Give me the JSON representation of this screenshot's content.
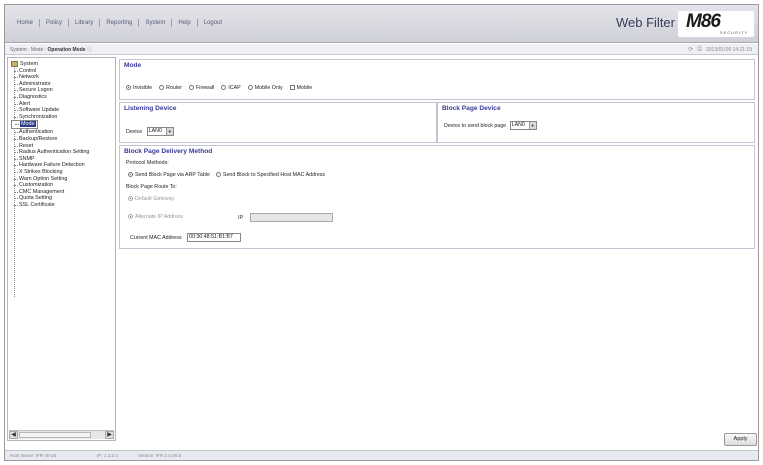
{
  "menu": [
    "Home",
    "Policy",
    "Library",
    "Reporting",
    "System",
    "Help",
    "Logout"
  ],
  "product_name": "Web Filter",
  "logo": {
    "main": "M86",
    "sub": "SECURITY"
  },
  "breadcrumb": {
    "prefix": "System : Mode : ",
    "current": "Operation Mode",
    "help_icon": "question-icon"
  },
  "datetime": "2013/01/09 14:21:19",
  "sidebar": {
    "root": "System",
    "items": [
      "Control",
      "Network",
      "Administrator",
      "Secure Logon",
      "Diagnostics",
      "Alert",
      "Software Update",
      "Synchronization",
      "Mode",
      "Authentication",
      "Backup/Restore",
      "Reset",
      "Radius Authentication Setting",
      "SNMP",
      "Hardware Failure Detection",
      "X Strikes Blocking",
      "Warn Option Setting",
      "Customization",
      "CMC Management",
      "Quota Setting",
      "SSL Certificate"
    ],
    "selected_index": 8
  },
  "mode": {
    "title": "Mode",
    "options": [
      "Invisible",
      "Router",
      "Firewall",
      "ICAP",
      "Mobile Only"
    ],
    "selected": "Invisible",
    "mobile_checkbox": "Mobile"
  },
  "listening": {
    "title": "Listening Device",
    "label": "Device",
    "value": "LAN0"
  },
  "blockdev": {
    "title": "Block Page Device",
    "label": "Device to send block page",
    "value": "LAN0"
  },
  "delivery": {
    "title": "Block Page Delivery Method",
    "protocol_label": "Protocol Methods:",
    "method_arp": "Send Block Page via ARP Table",
    "method_mac": "Send Block to Specified Host MAC Address",
    "route_label": "Block Page Route To:",
    "route_default": "Default Gateway",
    "route_alt": "Alternate IP Address",
    "ip_label": "IP",
    "ip_value": "",
    "mac_label": "Current MAC Address",
    "mac_value": "00:30:48:51:B1:B7"
  },
  "apply_label": "Apply",
  "status": {
    "host": "Host Name: IFR-40-26",
    "ip": "IP: 1.2.3.4",
    "version": "Version: IFR 2.0.00.5"
  }
}
